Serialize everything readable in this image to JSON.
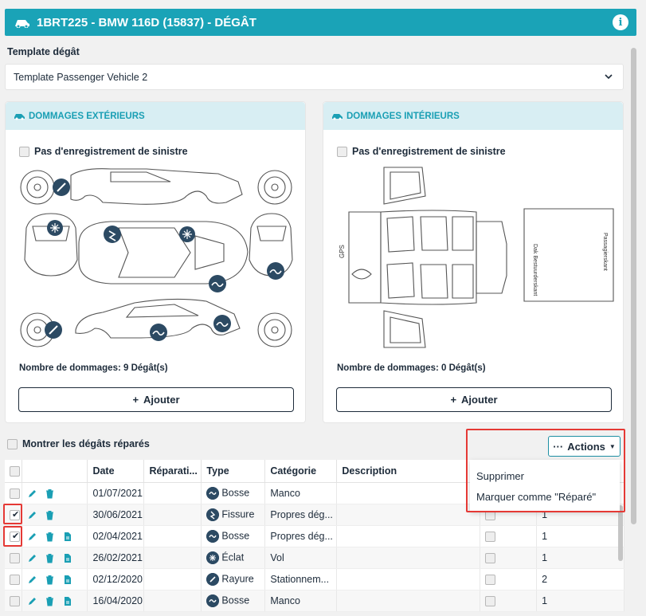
{
  "header": {
    "title": "1BRT225 - BMW 116D (15837) - DÉGÂT",
    "info_icon": "i"
  },
  "template": {
    "label": "Template dégât",
    "value": "Template Passenger Vehicle 2"
  },
  "exterior": {
    "title": "DOMMAGES EXTÉRIEURS",
    "no_claim": "Pas d'enregistrement de sinistre",
    "count_label": "Nombre de dommages:",
    "count_value": "9 Dégât(s)",
    "add_label": "Ajouter"
  },
  "interior": {
    "title": "DOMMAGES INTÉRIEURS",
    "no_claim": "Pas d'enregistrement de sinistre",
    "count_label": "Nombre de dommages:",
    "count_value": "0 Dégât(s)",
    "add_label": "Ajouter",
    "diagram_labels": {
      "gps": "GPS",
      "left": "Dak Bestuurderskant",
      "right": "Passagierskant"
    }
  },
  "repaired_toggle": "Montrer les dégâts réparés",
  "actions": {
    "button_label": "Actions",
    "menu": [
      "Supprimer",
      "Marquer comme \"Réparé\""
    ]
  },
  "table": {
    "columns": [
      "",
      "",
      "Date",
      "Réparati...",
      "Type",
      "Catégorie",
      "Description",
      "",
      ""
    ],
    "rows": [
      {
        "checked": false,
        "date": "01/07/2021",
        "type": "Bosse",
        "category": "Manco",
        "extra": "",
        "pdf": false
      },
      {
        "checked": true,
        "date": "30/06/2021",
        "type": "Fissure",
        "category": "Propres dég...",
        "extra": "1",
        "pdf": false
      },
      {
        "checked": true,
        "date": "02/04/2021",
        "type": "Bosse",
        "category": "Propres dég...",
        "extra": "1",
        "pdf": true
      },
      {
        "checked": false,
        "date": "26/02/2021",
        "type": "Éclat",
        "category": "Vol",
        "extra": "1",
        "pdf": true
      },
      {
        "checked": false,
        "date": "02/12/2020",
        "type": "Rayure",
        "category": "Stationnem...",
        "extra": "2",
        "pdf": true
      },
      {
        "checked": false,
        "date": "16/04/2020",
        "type": "Bosse",
        "category": "Manco",
        "extra": "1",
        "pdf": true
      }
    ]
  },
  "colors": {
    "accent": "#1aa3b7",
    "panel_header": "#d8eef3",
    "highlight": "#e53935",
    "marker": "#2c4a63"
  }
}
